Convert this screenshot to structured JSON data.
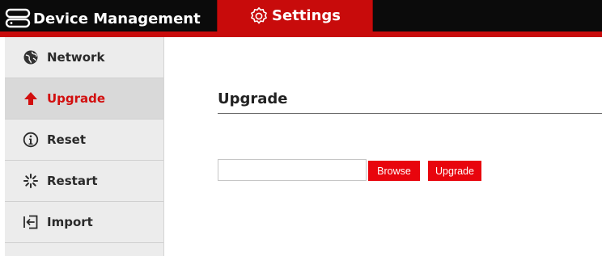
{
  "header": {
    "brand_label": "Device Management",
    "brand_icon": "device-icon",
    "active_tab_label": "Settings",
    "active_tab_icon": "gear-icon"
  },
  "sidebar": {
    "items": [
      {
        "label": "Network",
        "icon": "globe-icon",
        "active": false
      },
      {
        "label": "Upgrade",
        "icon": "arrow-up-icon",
        "active": true
      },
      {
        "label": "Reset",
        "icon": "info-icon",
        "active": false
      },
      {
        "label": "Restart",
        "icon": "spinner-icon",
        "active": false
      },
      {
        "label": "Import",
        "icon": "import-icon",
        "active": false
      }
    ]
  },
  "main": {
    "title": "Upgrade",
    "file_input_value": "",
    "browse_label": "Browse",
    "upgrade_label": "Upgrade"
  },
  "colors": {
    "accent_red": "#c80b0b",
    "button_red": "#e8050d",
    "topbar_black": "#0b0b0b",
    "sidebar_bg": "#ececec",
    "active_item_bg": "#d9d9d9"
  }
}
